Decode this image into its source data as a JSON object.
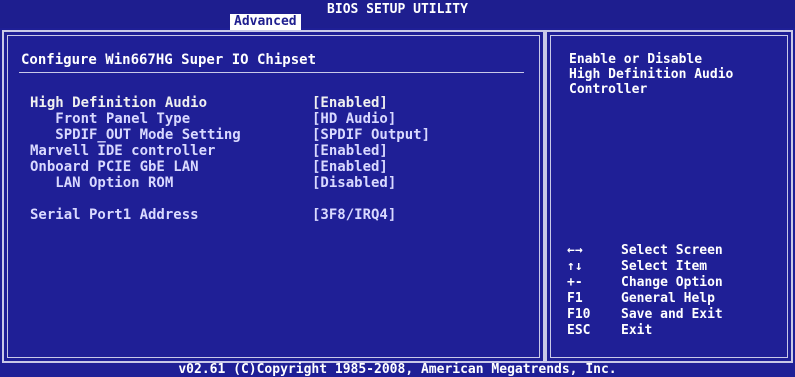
{
  "title": "BIOS SETUP UTILITY",
  "active_tab": "Advanced",
  "section_title": "Configure Win667HG Super IO Chipset",
  "items": [
    {
      "label": "High Definition Audio",
      "value": "[Enabled]"
    },
    {
      "label": "   Front Panel Type",
      "value": "[HD Audio]"
    },
    {
      "label": "   SPDIF_OUT Mode Setting",
      "value": "[SPDIF Output]"
    },
    {
      "label": "Marvell IDE controller",
      "value": "[Enabled]"
    },
    {
      "label": "Onboard PCIE GbE LAN",
      "value": "[Enabled]"
    },
    {
      "label": "   LAN Option ROM",
      "value": "[Disabled]"
    },
    {
      "label": "Serial Port1 Address",
      "value": "[3F8/IRQ4]"
    }
  ],
  "help_lines": [
    "Enable or Disable",
    "High Definition Audio",
    "Controller"
  ],
  "keys": [
    {
      "key": "←→",
      "desc": "Select Screen"
    },
    {
      "key": "↑↓",
      "desc": "Select Item"
    },
    {
      "key": "+-",
      "desc": "Change Option"
    },
    {
      "key": "F1",
      "desc": "General Help"
    },
    {
      "key": "F10",
      "desc": "Save and Exit"
    },
    {
      "key": "ESC",
      "desc": "Exit"
    }
  ],
  "footer": "v02.61 (C)Copyright 1985-2008, American Megatrends, Inc.",
  "colors": {
    "background": "#1f1f96",
    "text": "#ffffff",
    "border": "#c9c9e8"
  }
}
